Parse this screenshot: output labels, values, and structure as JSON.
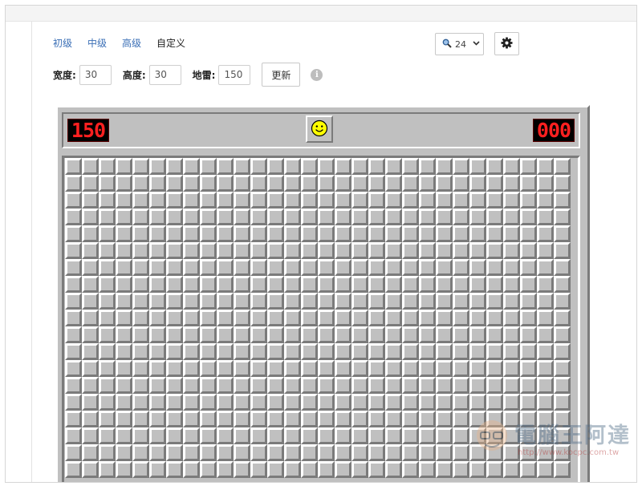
{
  "levels": {
    "beginner": "初级",
    "intermediate": "中级",
    "expert": "高级",
    "custom": "自定义"
  },
  "zoom": {
    "icon": "magnifier-icon",
    "value": "24"
  },
  "settings": {
    "width_label": "宽度:",
    "width_value": "30",
    "height_label": "高度:",
    "height_value": "30",
    "mines_label": "地雷:",
    "mines_value": "150",
    "update_button": "更新",
    "info_icon": "i"
  },
  "game": {
    "mine_counter": "150",
    "timer": "000",
    "face": "smiley-face",
    "columns": 30,
    "visible_rows": 19,
    "colors": {
      "board": "#c0c0c0",
      "highlight": "#ffffff",
      "shadow": "#7b7b7b",
      "lcd_digit": "#ff2020"
    }
  },
  "watermark": {
    "text": "電腦王阿達",
    "url": "http://www.kocpc.com.tw"
  }
}
